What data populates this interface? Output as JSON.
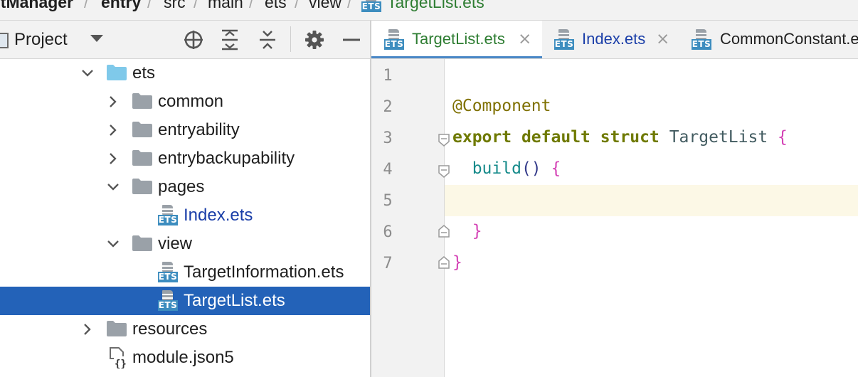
{
  "breadcrumb": {
    "items": [
      "etManager",
      "entry",
      "src",
      "main",
      "ets",
      "view",
      "TargetList.ets"
    ],
    "separator": "/"
  },
  "project_panel": {
    "title": "Project",
    "icons": [
      "project-icon",
      "locate-icon",
      "expand-all-icon",
      "collapse-all-icon",
      "gear-icon",
      "minimize-icon"
    ],
    "tree": [
      {
        "label": "ets",
        "kind": "folder",
        "expanded": true
      },
      {
        "label": "common",
        "kind": "folder",
        "expanded": false
      },
      {
        "label": "entryability",
        "kind": "folder",
        "expanded": false
      },
      {
        "label": "entrybackupability",
        "kind": "folder",
        "expanded": false
      },
      {
        "label": "pages",
        "kind": "folder",
        "expanded": true
      },
      {
        "label": "Index.ets",
        "kind": "file"
      },
      {
        "label": "view",
        "kind": "folder",
        "expanded": true
      },
      {
        "label": "TargetInformation.ets",
        "kind": "file"
      },
      {
        "label": "TargetList.ets",
        "kind": "file",
        "selected": true
      },
      {
        "label": "resources",
        "kind": "folder",
        "expanded": false
      },
      {
        "label": "module.json5",
        "kind": "json"
      }
    ]
  },
  "icon_badge": "ETS",
  "tabs": [
    {
      "label": "TargetList.ets",
      "active": true,
      "close": "×"
    },
    {
      "label": "Index.ets",
      "active": false,
      "close": "×"
    },
    {
      "label": "CommonConstant.ets",
      "active": false
    }
  ],
  "editor": {
    "line_numbers": [
      "1",
      "2",
      "3",
      "4",
      "5",
      "6",
      "7"
    ],
    "code": {
      "l2": "@Component",
      "l3_kw1": "export",
      "l3_kw2": "default",
      "l3_kw3": "struct",
      "l3_type": "TargetList",
      "l3_brace": "{",
      "l4_fn": "build",
      "l4_parens": "()",
      "l4_brace": "{",
      "l6_brace": "}",
      "l7_brace": "}"
    },
    "current_line": 5
  },
  "colors": {
    "selection": "#2362b8",
    "keyword": "#6f7a00",
    "brace": "#d442b5",
    "function": "#158a8a",
    "current_line_bg": "#fcf8e6",
    "tab_active_underline": "#4a88c7"
  }
}
